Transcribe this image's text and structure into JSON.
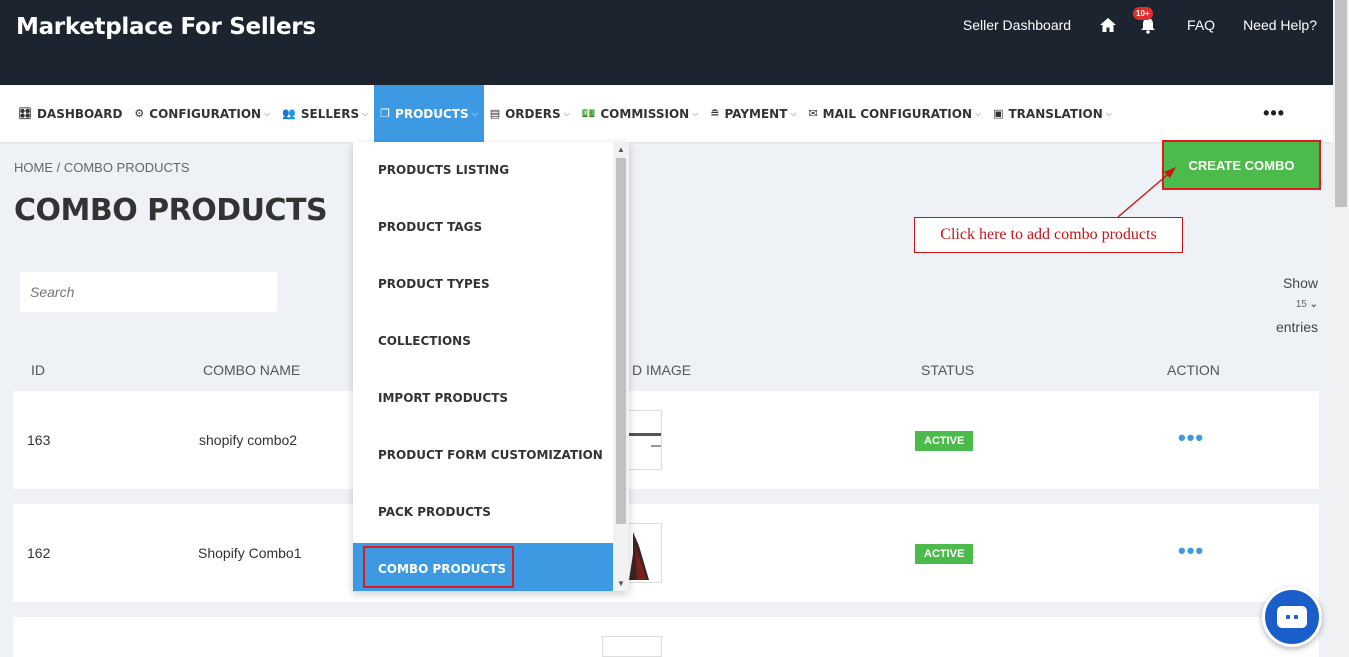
{
  "header": {
    "brand": "Marketplace For Sellers",
    "links": {
      "seller_dashboard": "Seller Dashboard",
      "faq": "FAQ",
      "help": "Need Help?"
    },
    "notification_badge": "10+"
  },
  "nav": {
    "items": [
      {
        "label": "DASHBOARD",
        "icon": "dashboard-icon",
        "glyph": "🎛"
      },
      {
        "label": "CONFIGURATION",
        "icon": "gear-icon",
        "glyph": "⚙"
      },
      {
        "label": "SELLERS",
        "icon": "users-icon",
        "glyph": "👥"
      },
      {
        "label": "PRODUCTS",
        "icon": "products-icon",
        "glyph": "❐"
      },
      {
        "label": "ORDERS",
        "icon": "orders-icon",
        "glyph": "▤"
      },
      {
        "label": "COMMISSION",
        "icon": "commission-icon",
        "glyph": "💵"
      },
      {
        "label": "PAYMENT",
        "icon": "payment-icon",
        "glyph": "≘"
      },
      {
        "label": "MAIL CONFIGURATION",
        "icon": "mail-icon",
        "glyph": "✉"
      },
      {
        "label": "TRANSLATION",
        "icon": "translation-icon",
        "glyph": "▣"
      }
    ],
    "more": "•••"
  },
  "dropdown": {
    "items": [
      "PRODUCTS LISTING",
      "PRODUCT TAGS",
      "PRODUCT TYPES",
      "COLLECTIONS",
      "IMPORT PRODUCTS",
      "PRODUCT FORM CUSTOMIZATION",
      "PACK PRODUCTS",
      "COMBO PRODUCTS"
    ]
  },
  "page": {
    "breadcrumb": "HOME / COMBO PRODUCTS",
    "title": "COMBO PRODUCTS",
    "create_button": "CREATE COMBO",
    "callout": "Click here to add combo products",
    "search_placeholder": "Search",
    "show_label": "Show",
    "show_value": "15",
    "entries_label": "entries"
  },
  "table": {
    "headers": {
      "id": "ID",
      "name": "COMBO NAME",
      "image": "D IMAGE",
      "status": "STATUS",
      "action": "ACTION"
    },
    "rows": [
      {
        "id": "163",
        "name": "shopify combo2",
        "status": "ACTIVE"
      },
      {
        "id": "162",
        "name": "Shopify Combo1",
        "status": "ACTIVE"
      }
    ]
  },
  "colors": {
    "accent": "#3d9ae2",
    "success": "#4cbb4c",
    "header_bg": "#1c2430",
    "highlight": "#e11b1b"
  }
}
